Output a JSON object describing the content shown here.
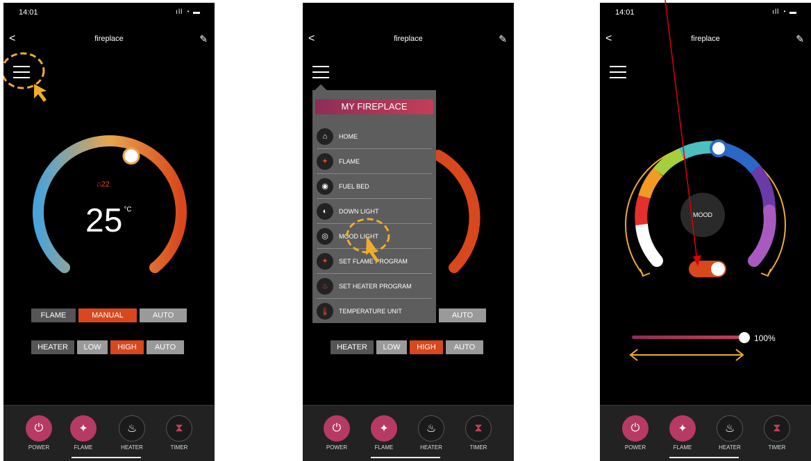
{
  "status": {
    "time": "14:01",
    "signal": ""
  },
  "nav": {
    "title": "fireplace",
    "back": "<",
    "edit": "✎"
  },
  "screen1": {
    "room_temp": "22",
    "set_temp": "25",
    "unit": "°C",
    "flame_row": [
      "FLAME",
      "MANUAL",
      "AUTO"
    ],
    "heater_row": [
      "HEATER",
      "LOW",
      "HIGH",
      "AUTO"
    ]
  },
  "screen2": {
    "menu_title": "MY FIREPLACE",
    "menu_items": [
      "HOME",
      "FLAME",
      "FUEL BED",
      "DOWN LIGHT",
      "MOOD LIGHT",
      "SET FLAME PROGRAM",
      "SET HEATER PROGRAM",
      "TEMPERATURE UNIT"
    ],
    "flame_row": [
      "AUTO"
    ],
    "heater_row": [
      "HEATER",
      "LOW",
      "HIGH",
      "AUTO"
    ]
  },
  "screen3": {
    "knob_label": "MOOD",
    "brightness": "100%"
  },
  "tabs": [
    "POWER",
    "FLAME",
    "HEATER",
    "TIMER"
  ],
  "colors": {
    "accent": "#d9471c",
    "pink": "#c33e59",
    "annot": "#f0ad2c",
    "pointer": "#e00000"
  }
}
